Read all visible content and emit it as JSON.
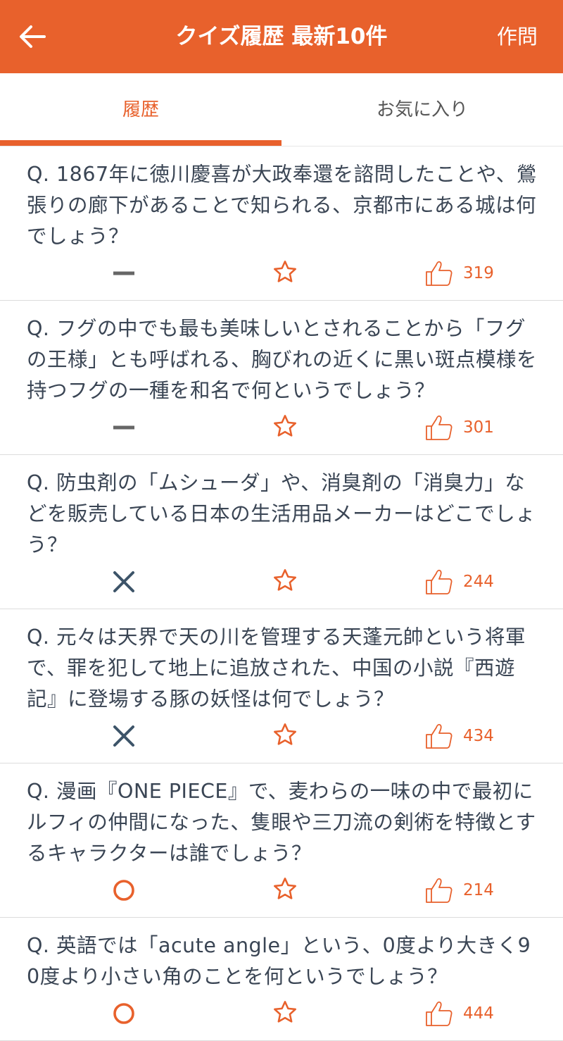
{
  "colors": {
    "accent": "#e8612c",
    "correct": "#e8612c",
    "wrong": "#3d5469",
    "unanswered": "#666666"
  },
  "header": {
    "back_icon": "arrow-left-icon",
    "title": "クイズ履歴 最新10件",
    "action_label": "作問"
  },
  "tabs": [
    {
      "label": "履歴",
      "active": true
    },
    {
      "label": "お気に入り",
      "active": false
    }
  ],
  "quizzes": [
    {
      "question": "Q. 1867年に徳川慶喜が大政奉還を諮問したことや、鶯張りの廊下があることで知られる、京都市にある城は何でしょう？",
      "result": "unanswered",
      "result_icon": "dash-icon",
      "favorite_icon": "star-outline-icon",
      "like_icon": "thumbs-up-icon",
      "likes": "319"
    },
    {
      "question": "Q. フグの中でも最も美味しいとされることから「フグの王様」とも呼ばれる、胸びれの近くに黒い斑点模様を持つフグの一種を和名で何というでしょう？",
      "result": "unanswered",
      "result_icon": "dash-icon",
      "favorite_icon": "star-outline-icon",
      "like_icon": "thumbs-up-icon",
      "likes": "301"
    },
    {
      "question": "Q. 防虫剤の「ムシューダ」や、消臭剤の「消臭力」などを販売している日本の生活用品メーカーはどこでしょう？",
      "result": "wrong",
      "result_icon": "cross-icon",
      "favorite_icon": "star-outline-icon",
      "like_icon": "thumbs-up-icon",
      "likes": "244"
    },
    {
      "question": "Q. 元々は天界で天の川を管理する天蓬元帥という将軍で、罪を犯して地上に追放された、中国の小説『西遊記』に登場する豚の妖怪は何でしょう？",
      "result": "wrong",
      "result_icon": "cross-icon",
      "favorite_icon": "star-outline-icon",
      "like_icon": "thumbs-up-icon",
      "likes": "434"
    },
    {
      "question": "Q. 漫画『ONE PIECE』で、麦わらの一味の中で最初にルフィの仲間になった、隻眼や三刀流の剣術を特徴とするキャラクターは誰でしょう？",
      "result": "correct",
      "result_icon": "circle-icon",
      "favorite_icon": "star-outline-icon",
      "like_icon": "thumbs-up-icon",
      "likes": "214"
    },
    {
      "question": "Q. 英語では「acute angle」という、0度より大きく90度より小さい角のことを何というでしょう？",
      "result": "correct",
      "result_icon": "circle-icon",
      "favorite_icon": "star-outline-icon",
      "like_icon": "thumbs-up-icon",
      "likes": "444"
    }
  ]
}
